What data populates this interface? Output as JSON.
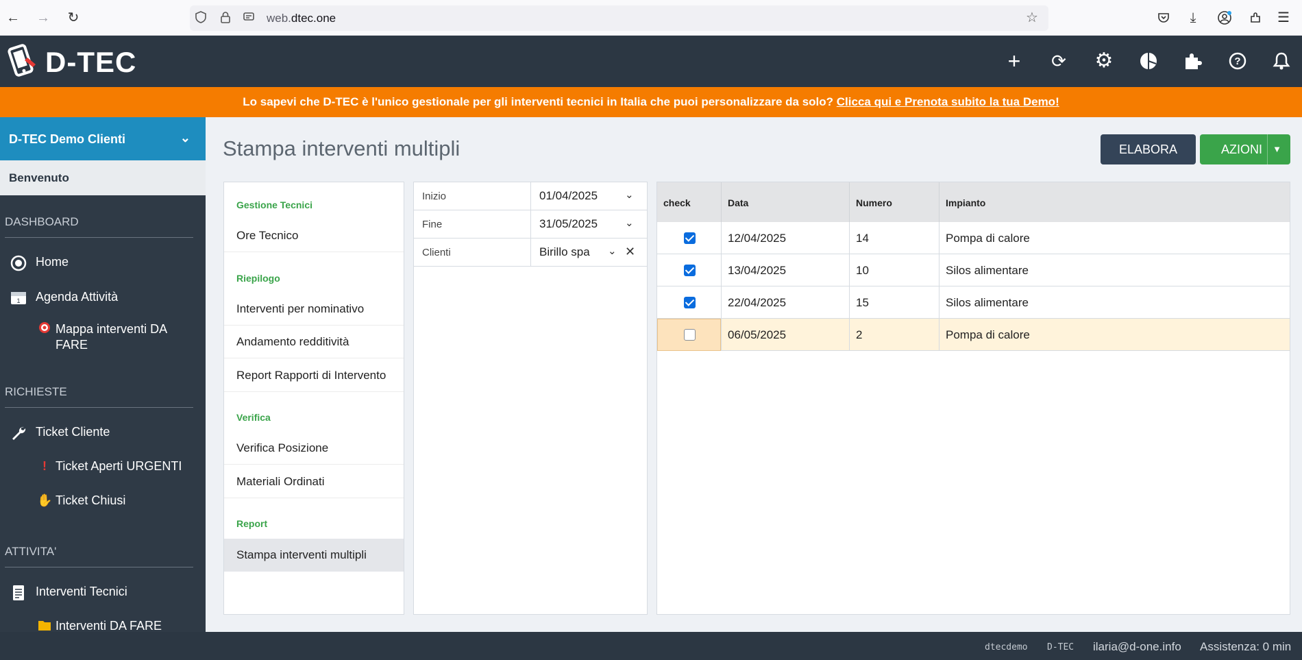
{
  "browser": {
    "url_prefix": "web.",
    "url_domain": "dtec.one"
  },
  "header": {
    "logo_text": "D-TEC"
  },
  "banner": {
    "text": "Lo sapevi che D-TEC è l'unico gestionale per gli interventi tecnici in Italia che puoi personalizzare da solo?",
    "link": "Clicca qui e Prenota subito la tua Demo!"
  },
  "sidebar": {
    "account": "D-TEC Demo Clienti",
    "welcome": "Benvenuto",
    "sections": {
      "dashboard": "DASHBOARD",
      "richieste": "RICHIESTE",
      "attivita": "ATTIVITA'"
    },
    "items": {
      "home": "Home",
      "agenda": "Agenda Attività",
      "mappa": "Mappa interventi DA FARE",
      "ticket_cliente": "Ticket Cliente",
      "ticket_urgenti": "Ticket Aperti URGENTI",
      "ticket_chiusi": "Ticket Chiusi",
      "interventi_tecnici": "Interventi Tecnici",
      "interventi_da_fare": "Interventi DA FARE"
    }
  },
  "main": {
    "title": "Stampa interventi multipli",
    "elabora_label": "ELABORA",
    "azioni_label": "AZIONI"
  },
  "menu": {
    "gestione_tecnici": "Gestione Tecnici",
    "ore_tecnico": "Ore Tecnico",
    "riepilogo": "Riepilogo",
    "interventi_nominativo": "Interventi per nominativo",
    "andamento": "Andamento redditività",
    "report_rapporti": "Report Rapporti di Intervento",
    "verifica": "Verifica",
    "verifica_posizione": "Verifica Posizione",
    "materiali": "Materiali Ordinati",
    "report": "Report",
    "stampa": "Stampa interventi multipli"
  },
  "filters": {
    "inizio_label": "Inizio",
    "inizio_value": "01/04/2025",
    "fine_label": "Fine",
    "fine_value": "31/05/2025",
    "clienti_label": "Clienti",
    "clienti_value": "Birillo spa"
  },
  "table": {
    "headers": [
      "check",
      "Data",
      "Numero",
      "Impianto"
    ],
    "rows": [
      {
        "checked": true,
        "data": "12/04/2025",
        "numero": "14",
        "impianto": "Pompa di calore"
      },
      {
        "checked": true,
        "data": "13/04/2025",
        "numero": "10",
        "impianto": "Silos alimentare"
      },
      {
        "checked": true,
        "data": "22/04/2025",
        "numero": "15",
        "impianto": "Silos alimentare"
      },
      {
        "checked": false,
        "data": "06/05/2025",
        "numero": "2",
        "impianto": "Pompa di calore"
      }
    ]
  },
  "footer": {
    "user_code": "dtecdemo",
    "app": "D-TEC",
    "email": "ilaria@d-one.info",
    "assistenza": "Assistenza: 0 min"
  },
  "colors": {
    "header_bg": "#2c3743",
    "banner_bg": "#f57c00",
    "account_bg": "#1e8dbf",
    "accent_green": "#3aa44a",
    "checkbox_blue": "#0a6cde"
  }
}
